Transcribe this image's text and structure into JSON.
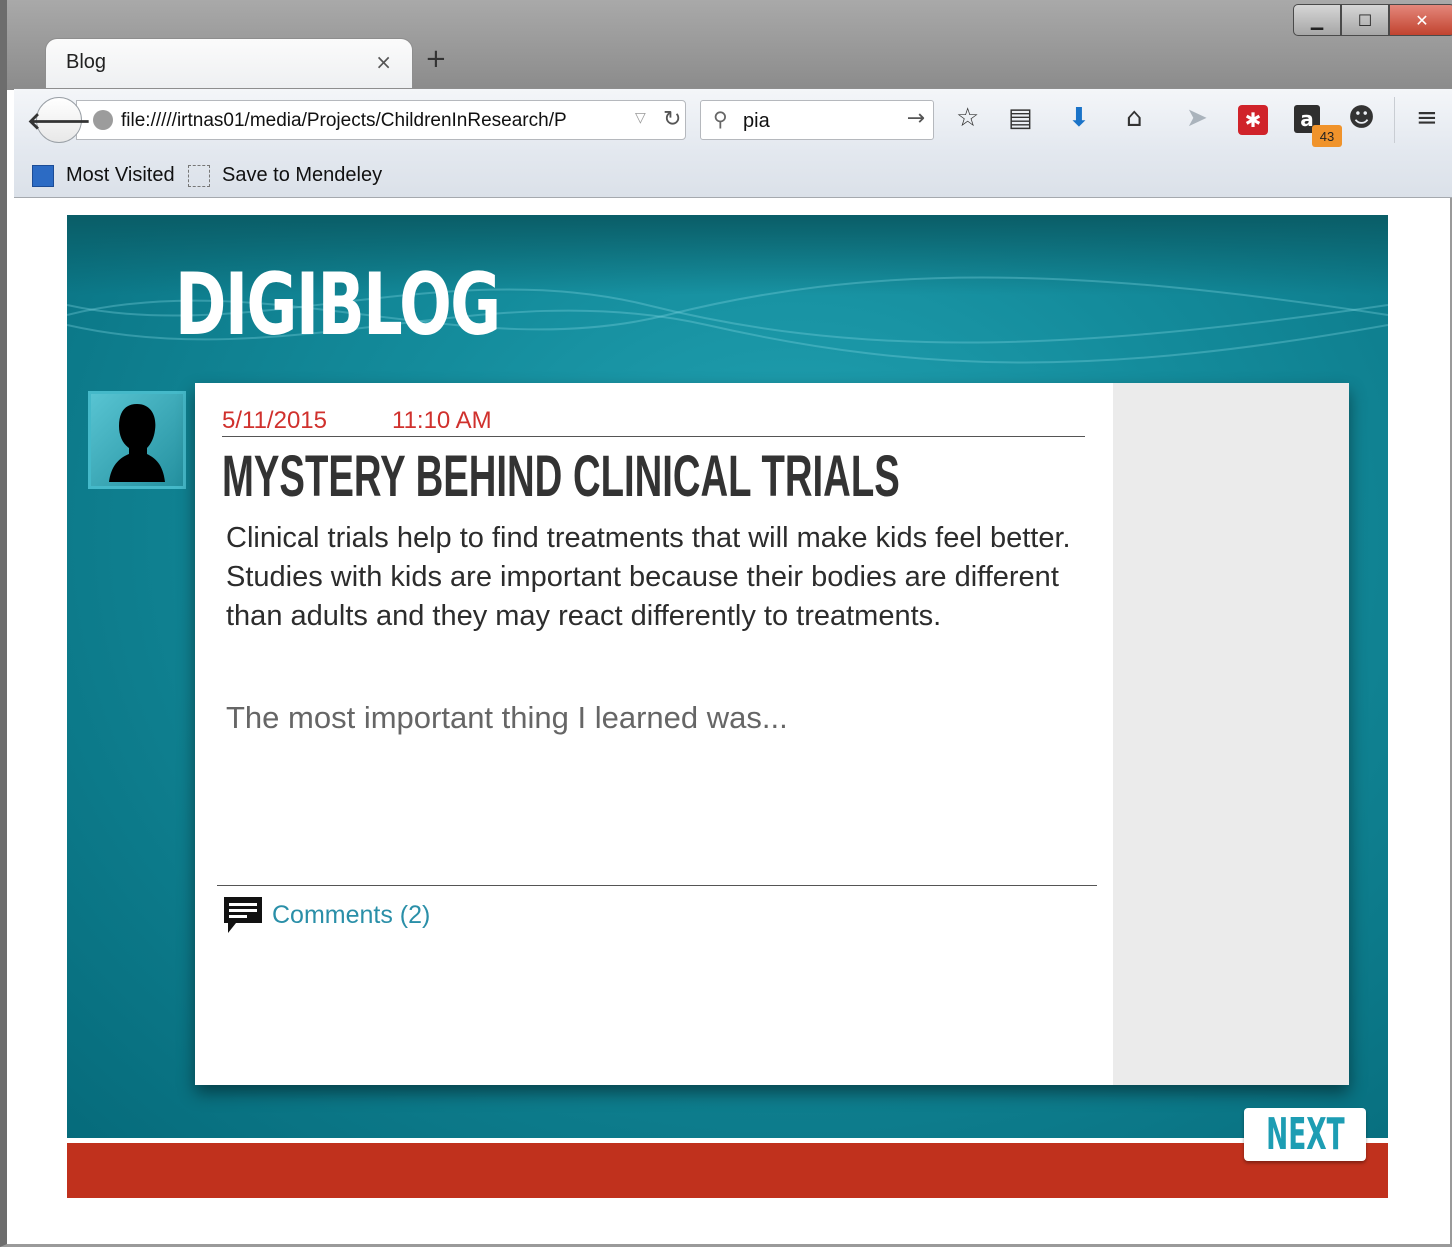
{
  "browser": {
    "tab_title": "Blog",
    "tab_close": "×",
    "new_tab": "+",
    "url": "file://///irtnas01/media/Projects/ChildrenInResearch/P",
    "search_value": "pia",
    "amazon_badge": "43",
    "bookmarks": [
      {
        "label": "Most Visited",
        "icon": "most-visited-icon"
      },
      {
        "label": "Save to Mendeley",
        "icon": "mendeley-icon"
      }
    ],
    "window_controls": {
      "minimize": "▁",
      "maximize": "☐",
      "close": "✕"
    }
  },
  "blog": {
    "logo": "DIGIBLOG",
    "date": "5/11/2015",
    "time": "11:10 AM",
    "title": "MYSTERY BEHIND CLINICAL TRIALS",
    "body": "Clinical trials help to find treatments that will make kids feel better.  Studies with kids are important because their bodies are different than adults and they may react differently to treatments.",
    "response_placeholder": "The most important thing I learned was...",
    "comments_label": "Comments (2)",
    "next_label": "NEXT"
  },
  "colors": {
    "teal": "#148c9c",
    "accent_red": "#c0311d",
    "date_red": "#d0312d",
    "link_blue": "#2a8fa8"
  }
}
